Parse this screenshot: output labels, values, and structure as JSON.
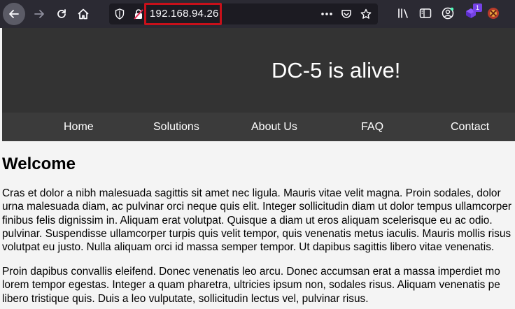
{
  "browser": {
    "url": "192.168.94.26",
    "extension_badge": "1"
  },
  "site": {
    "title": "DC-5 is alive!",
    "nav": [
      "Home",
      "Solutions",
      "About Us",
      "FAQ",
      "Contact"
    ]
  },
  "content": {
    "heading": "Welcome",
    "paragraph1": [
      "Cras et dolor a nibh malesuada sagittis sit amet nec ligula. Mauris vitae velit magna. Proin sodales, dolor",
      "urna malesuada diam, ac pulvinar orci neque quis elit. Integer sollicitudin diam ut dolor tempus ullamcorper",
      "finibus felis dignissim in. Aliquam erat volutpat. Quisque a diam ut eros aliquam scelerisque eu ac odio.",
      "pulvinar. Suspendisse ullamcorper turpis quis velit tempor, quis venenatis metus iaculis. Mauris mollis risus",
      "volutpat eu justo. Nulla aliquam orci id massa semper tempor. Ut dapibus sagittis libero vitae venenatis."
    ],
    "paragraph2": [
      "Proin dapibus convallis eleifend. Donec venenatis leo arcu. Donec accumsan erat a massa imperdiet mo",
      "lorem tempor egestas. Integer a quam pharetra, ultricies ipsum non, sodales risus. Aliquam venenatis pe",
      "libero tristique quis. Duis a leo vulputate, sollicitudin lectus vel, pulvinar risus."
    ]
  },
  "colors": {
    "toolbar": "#2b2a33",
    "urlbar": "#1c1b22",
    "header": "#333333",
    "nav": "#3b3b3b",
    "highlight": "#c8101a",
    "page_bg": "#f4f4f4"
  },
  "icons": {
    "back": "back-arrow-icon",
    "forward": "forward-arrow-icon",
    "reload": "reload-icon",
    "home": "home-icon",
    "tracking": "shield-icon",
    "insecure": "insecure-lock-icon",
    "more": "ellipsis-icon",
    "pocket": "pocket-icon",
    "bookmark": "star-icon",
    "library": "library-icon",
    "sidebar": "sidebar-icon",
    "account": "account-icon",
    "extension1": "extension-icon",
    "extension2": "extension-icon"
  }
}
